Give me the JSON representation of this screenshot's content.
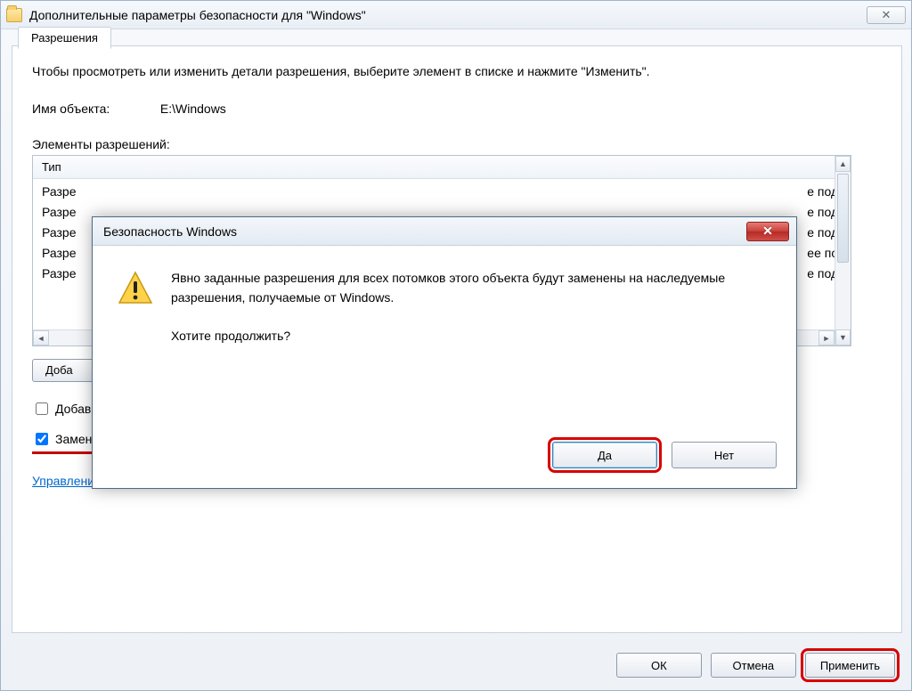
{
  "window": {
    "title": "Дополнительные параметры безопасности  для \"Windows\"",
    "close_glyph": "✕"
  },
  "tab": {
    "label": "Разрешения"
  },
  "instr": "Чтобы просмотреть или изменить детали разрешения, выберите элемент в списке и нажмите \"Изменить\".",
  "obj": {
    "label": "Имя объекта:",
    "value": "E:\\Windows"
  },
  "elems_label": "Элементы разрешений:",
  "list": {
    "header_type": "Тип",
    "rows": [
      {
        "type": "Разре",
        "tail": "е под."
      },
      {
        "type": "Разре",
        "tail": "е под."
      },
      {
        "type": "Разре",
        "tail": "е под."
      },
      {
        "type": "Разре",
        "tail": "ее по."
      },
      {
        "type": "Разре",
        "tail": "е под."
      }
    ]
  },
  "add_btn": "Доба",
  "chk1": {
    "label": "Добавить разрешения, наследуемые от родительских объектов"
  },
  "chk2": {
    "label": "Заменить все разрешения дочернего объекта на разрешения, наследуемые от этого объекта"
  },
  "link": "Управление разрешениями",
  "buttons": {
    "ok": "ОК",
    "cancel": "Отмена",
    "apply": "Применить"
  },
  "modal": {
    "title": "Безопасность Windows",
    "close_glyph": "✕",
    "line1": "Явно заданные разрешения для всех потомков этого объекта будут заменены на наследуемые разрешения, получаемые от Windows.",
    "line2": "Хотите продолжить?",
    "yes": "Да",
    "no": "Нет"
  }
}
